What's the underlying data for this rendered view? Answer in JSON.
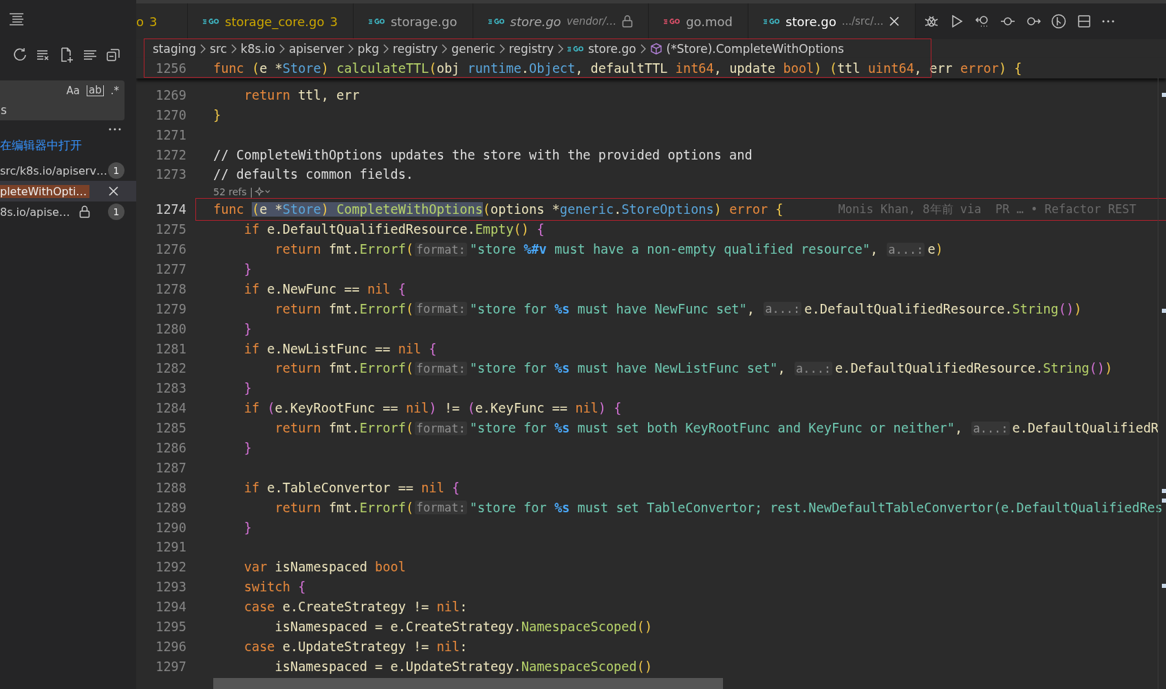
{
  "sidebar": {
    "search": {
      "value": "s",
      "toggles": [
        "Aa",
        "ab",
        ".*"
      ]
    },
    "link": "在编辑器中打开",
    "results": [
      {
        "text": "src/k8s.io/apiserv…",
        "badge": "1",
        "locked": false,
        "selected": false
      },
      {
        "text": "pleteWithOpti…",
        "locked": false,
        "selected": true
      },
      {
        "text": "8s.io/apise…",
        "badge": "1",
        "locked": true,
        "selected": false
      }
    ]
  },
  "tabs": [
    {
      "label": "o",
      "badge": "3",
      "warning": true,
      "preview": false,
      "locked": false,
      "selected": false
    },
    {
      "label": "storage_core.go",
      "badge": "3",
      "color": "#3fb9c6",
      "warning": true,
      "preview": false,
      "locked": false,
      "selected": false
    },
    {
      "label": "storage.go",
      "color": "#3fb9c6",
      "warning": false,
      "preview": false,
      "locked": false,
      "selected": false
    },
    {
      "label": "store.go",
      "detail": "vendor/…",
      "color": "#3fb9c6",
      "warning": false,
      "preview": true,
      "locked": true,
      "selected": false
    },
    {
      "label": "go.mod",
      "color": "#e0516b",
      "warning": false,
      "preview": false,
      "locked": false,
      "selected": false
    },
    {
      "label": "store.go",
      "detail": ".../src/...",
      "color": "#3fb9c6",
      "warning": false,
      "preview": false,
      "locked": false,
      "selected": true
    }
  ],
  "breadcrumbs": [
    {
      "label": "staging",
      "kind": "folder"
    },
    {
      "label": "src",
      "kind": "folder"
    },
    {
      "label": "k8s.io",
      "kind": "folder"
    },
    {
      "label": "apiserver",
      "kind": "folder"
    },
    {
      "label": "pkg",
      "kind": "folder"
    },
    {
      "label": "registry",
      "kind": "folder"
    },
    {
      "label": "generic",
      "kind": "folder"
    },
    {
      "label": "registry",
      "kind": "folder"
    },
    {
      "label": "store.go",
      "kind": "file"
    },
    {
      "label": "(*Store).CompleteWithOptions",
      "kind": "symbol"
    }
  ],
  "sticky_line": {
    "number": "1256",
    "tokens": [
      {
        "kind": "kw",
        "text": "func "
      },
      {
        "kind": "paren",
        "text": "("
      },
      {
        "kind": "plain",
        "text": "e *"
      },
      {
        "kind": "type",
        "text": "Store"
      },
      {
        "kind": "paren",
        "text": ") "
      },
      {
        "kind": "fn",
        "text": "calculateTTL"
      },
      {
        "kind": "paren",
        "text": "("
      },
      {
        "kind": "plain",
        "text": "obj "
      },
      {
        "kind": "type",
        "text": "runtime"
      },
      {
        "kind": "plain",
        "text": "."
      },
      {
        "kind": "type",
        "text": "Object"
      },
      {
        "kind": "plain",
        "text": ", defaultTTL "
      },
      {
        "kind": "kw",
        "text": "int64"
      },
      {
        "kind": "plain",
        "text": ", update "
      },
      {
        "kind": "kw",
        "text": "bool"
      },
      {
        "kind": "paren",
        "text": ") ("
      },
      {
        "kind": "plain",
        "text": "ttl "
      },
      {
        "kind": "kw",
        "text": "uint64"
      },
      {
        "kind": "plain",
        "text": ", err "
      },
      {
        "kind": "kw",
        "text": "error"
      },
      {
        "kind": "paren",
        "text": ") {"
      }
    ]
  },
  "lines": [
    {
      "number": "1269",
      "current": false,
      "tokens": [
        {
          "kind": "kw",
          "text": "    return"
        },
        {
          "kind": "plain",
          "text": " ttl, err"
        }
      ]
    },
    {
      "number": "1270",
      "current": false,
      "tokens": [
        {
          "kind": "paren",
          "text": "}"
        }
      ]
    },
    {
      "number": "1271",
      "current": false
    },
    {
      "number": "1272",
      "current": false,
      "tokens": [
        {
          "kind": "comment",
          "text": "// CompleteWithOptions updates the store with the provided options and"
        }
      ]
    },
    {
      "number": "1273",
      "current": false,
      "tokens": [
        {
          "kind": "comment",
          "text": "// defaults common fields."
        }
      ]
    },
    {
      "number": "1274",
      "current": true,
      "codelens": "52 refs |",
      "tokens": [
        {
          "kind": "kw",
          "text": "func "
        }
      ],
      "selection": [
        {
          "kind": "paren",
          "text": "("
        },
        {
          "kind": "plain",
          "text": "e *"
        },
        {
          "kind": "type",
          "text": "Store"
        },
        {
          "kind": "paren",
          "text": ") "
        },
        {
          "kind": "fn",
          "text": "CompleteWithOptions"
        }
      ],
      "after": [
        {
          "kind": "paren",
          "text": "("
        },
        {
          "kind": "plain",
          "text": "options *"
        },
        {
          "kind": "type",
          "text": "generic"
        },
        {
          "kind": "plain",
          "text": "."
        },
        {
          "kind": "type",
          "text": "StoreOptions"
        },
        {
          "kind": "paren",
          "text": ") "
        },
        {
          "kind": "kw",
          "text": "error "
        },
        {
          "kind": "paren",
          "text": "{"
        }
      ],
      "blame": "Monis Khan, 8年前 via  PR … • Refactor REST"
    },
    {
      "number": "1275",
      "current": false,
      "tokens": [
        {
          "kind": "kw",
          "text": "    if"
        },
        {
          "kind": "plain",
          "text": " e.DefaultQualifiedResource."
        },
        {
          "kind": "fn",
          "text": "Empty"
        },
        {
          "kind": "paren",
          "text": "() "
        },
        {
          "kind": "brace",
          "text": "{"
        }
      ]
    },
    {
      "number": "1276",
      "current": false,
      "tokens": [
        {
          "kind": "kw",
          "text": "        return"
        },
        {
          "kind": "plain",
          "text": " fmt."
        },
        {
          "kind": "fn",
          "text": "Errorf"
        },
        {
          "kind": "paren",
          "text": "("
        },
        {
          "kind": "hint",
          "text": "format:"
        },
        {
          "kind": "str",
          "text": "\"store "
        },
        {
          "kind": "verb",
          "text": "%#v"
        },
        {
          "kind": "str",
          "text": " must have a non-empty qualified resource\""
        },
        {
          "kind": "plain",
          "text": ", "
        },
        {
          "kind": "hint",
          "text": "a...:"
        },
        {
          "kind": "plain",
          "text": "e"
        },
        {
          "kind": "paren",
          "text": ")"
        }
      ]
    },
    {
      "number": "1277",
      "current": false,
      "tokens": [
        {
          "kind": "brace",
          "text": "    }"
        }
      ]
    },
    {
      "number": "1278",
      "current": false,
      "tokens": [
        {
          "kind": "kw",
          "text": "    if"
        },
        {
          "kind": "plain",
          "text": " e.NewFunc == "
        },
        {
          "kind": "kw",
          "text": "nil "
        },
        {
          "kind": "brace",
          "text": "{"
        }
      ]
    },
    {
      "number": "1279",
      "current": false,
      "tokens": [
        {
          "kind": "kw",
          "text": "        return"
        },
        {
          "kind": "plain",
          "text": " fmt."
        },
        {
          "kind": "fn",
          "text": "Errorf"
        },
        {
          "kind": "paren",
          "text": "("
        },
        {
          "kind": "hint",
          "text": "format:"
        },
        {
          "kind": "str",
          "text": "\"store for "
        },
        {
          "kind": "verb",
          "text": "%s"
        },
        {
          "kind": "str",
          "text": " must have NewFunc set\""
        },
        {
          "kind": "plain",
          "text": ", "
        },
        {
          "kind": "hint",
          "text": "a...:"
        },
        {
          "kind": "plain",
          "text": "e.DefaultQualifiedResource."
        },
        {
          "kind": "fn",
          "text": "String"
        },
        {
          "kind": "brace",
          "text": "()"
        },
        {
          "kind": "paren",
          "text": ")"
        }
      ]
    },
    {
      "number": "1280",
      "current": false,
      "tokens": [
        {
          "kind": "brace",
          "text": "    }"
        }
      ]
    },
    {
      "number": "1281",
      "current": false,
      "tokens": [
        {
          "kind": "kw",
          "text": "    if"
        },
        {
          "kind": "plain",
          "text": " e.NewListFunc == "
        },
        {
          "kind": "kw",
          "text": "nil "
        },
        {
          "kind": "brace",
          "text": "{"
        }
      ]
    },
    {
      "number": "1282",
      "current": false,
      "tokens": [
        {
          "kind": "kw",
          "text": "        return"
        },
        {
          "kind": "plain",
          "text": " fmt."
        },
        {
          "kind": "fn",
          "text": "Errorf"
        },
        {
          "kind": "paren",
          "text": "("
        },
        {
          "kind": "hint",
          "text": "format:"
        },
        {
          "kind": "str",
          "text": "\"store for "
        },
        {
          "kind": "verb",
          "text": "%s"
        },
        {
          "kind": "str",
          "text": " must have NewListFunc set\""
        },
        {
          "kind": "plain",
          "text": ", "
        },
        {
          "kind": "hint",
          "text": "a...:"
        },
        {
          "kind": "plain",
          "text": "e.DefaultQualifiedResource."
        },
        {
          "kind": "fn",
          "text": "String"
        },
        {
          "kind": "brace",
          "text": "()"
        },
        {
          "kind": "paren",
          "text": ")"
        }
      ]
    },
    {
      "number": "1283",
      "current": false,
      "tokens": [
        {
          "kind": "brace",
          "text": "    }"
        }
      ]
    },
    {
      "number": "1284",
      "current": false,
      "tokens": [
        {
          "kind": "kw",
          "text": "    if "
        },
        {
          "kind": "brace",
          "text": "("
        },
        {
          "kind": "plain",
          "text": "e.KeyRootFunc == "
        },
        {
          "kind": "kw",
          "text": "nil"
        },
        {
          "kind": "brace",
          "text": ")"
        },
        {
          "kind": "plain",
          "text": " != "
        },
        {
          "kind": "brace",
          "text": "("
        },
        {
          "kind": "plain",
          "text": "e.KeyFunc == "
        },
        {
          "kind": "kw",
          "text": "nil"
        },
        {
          "kind": "brace",
          "text": ") {"
        }
      ]
    },
    {
      "number": "1285",
      "current": false,
      "tokens": [
        {
          "kind": "kw",
          "text": "        return"
        },
        {
          "kind": "plain",
          "text": " fmt."
        },
        {
          "kind": "fn",
          "text": "Errorf"
        },
        {
          "kind": "paren",
          "text": "("
        },
        {
          "kind": "hint",
          "text": "format:"
        },
        {
          "kind": "str",
          "text": "\"store for "
        },
        {
          "kind": "verb",
          "text": "%s"
        },
        {
          "kind": "str",
          "text": " must set both KeyRootFunc and KeyFunc or neither\""
        },
        {
          "kind": "plain",
          "text": ", "
        },
        {
          "kind": "hint",
          "text": "a...:"
        },
        {
          "kind": "plain",
          "text": "e.DefaultQualifiedR"
        }
      ]
    },
    {
      "number": "1286",
      "current": false,
      "tokens": [
        {
          "kind": "brace",
          "text": "    }"
        }
      ]
    },
    {
      "number": "1287",
      "current": false
    },
    {
      "number": "1288",
      "current": false,
      "tokens": [
        {
          "kind": "kw",
          "text": "    if"
        },
        {
          "kind": "plain",
          "text": " e.TableConvertor == "
        },
        {
          "kind": "kw",
          "text": "nil "
        },
        {
          "kind": "brace",
          "text": "{"
        }
      ]
    },
    {
      "number": "1289",
      "current": false,
      "tokens": [
        {
          "kind": "kw",
          "text": "        return"
        },
        {
          "kind": "plain",
          "text": " fmt."
        },
        {
          "kind": "fn",
          "text": "Errorf"
        },
        {
          "kind": "paren",
          "text": "("
        },
        {
          "kind": "hint",
          "text": "format:"
        },
        {
          "kind": "str",
          "text": "\"store for "
        },
        {
          "kind": "verb",
          "text": "%s"
        },
        {
          "kind": "str",
          "text": " must set TableConvertor; rest.NewDefaultTableConvertor(e.DefaultQualifiedRes"
        }
      ]
    },
    {
      "number": "1290",
      "current": false,
      "tokens": [
        {
          "kind": "brace",
          "text": "    }"
        }
      ]
    },
    {
      "number": "1291",
      "current": false
    },
    {
      "number": "1292",
      "current": false,
      "tokens": [
        {
          "kind": "kw",
          "text": "    var"
        },
        {
          "kind": "plain",
          "text": " isNamespaced "
        },
        {
          "kind": "kw",
          "text": "bool"
        }
      ]
    },
    {
      "number": "1293",
      "current": false,
      "tokens": [
        {
          "kind": "kw",
          "text": "    switch "
        },
        {
          "kind": "brace",
          "text": "{"
        }
      ]
    },
    {
      "number": "1294",
      "current": false,
      "tokens": [
        {
          "kind": "kw",
          "text": "    case"
        },
        {
          "kind": "plain",
          "text": " e.CreateStrategy != "
        },
        {
          "kind": "kw",
          "text": "nil"
        },
        {
          "kind": "plain",
          "text": ":"
        }
      ]
    },
    {
      "number": "1295",
      "current": false,
      "tokens": [
        {
          "kind": "plain",
          "text": "        isNamespaced = e.CreateStrategy."
        },
        {
          "kind": "fn",
          "text": "NamespaceScoped"
        },
        {
          "kind": "paren",
          "text": "()"
        }
      ]
    },
    {
      "number": "1296",
      "current": false,
      "tokens": [
        {
          "kind": "kw",
          "text": "    case"
        },
        {
          "kind": "plain",
          "text": " e.UpdateStrategy != "
        },
        {
          "kind": "kw",
          "text": "nil"
        },
        {
          "kind": "plain",
          "text": ":"
        }
      ]
    },
    {
      "number": "1297",
      "current": false,
      "tokens": [
        {
          "kind": "plain",
          "text": "        isNamespaced = e.UpdateStrategy."
        },
        {
          "kind": "fn",
          "text": "NamespaceScoped"
        },
        {
          "kind": "paren",
          "text": "()"
        }
      ]
    }
  ]
}
